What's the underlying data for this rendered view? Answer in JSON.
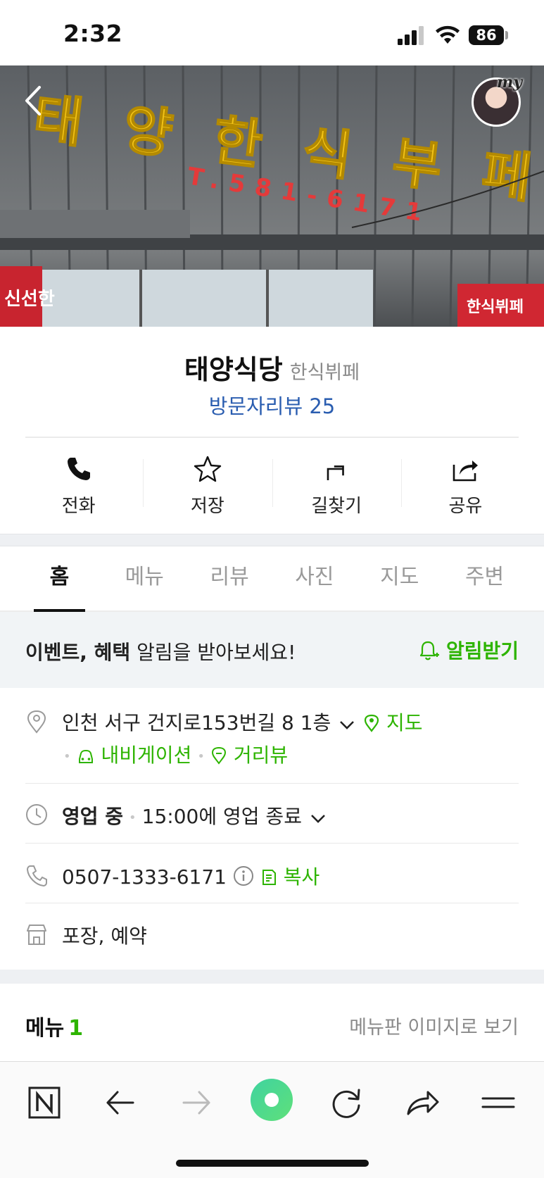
{
  "status_bar": {
    "time": "2:32",
    "battery": "86"
  },
  "hero": {
    "sign_main": "태 양 한 식 부 페",
    "sign_phone": "T.581-6171",
    "sign_side": "한식뷔페",
    "sign_left": "신선한",
    "my_label": "my"
  },
  "place": {
    "name": "태양식당",
    "category": "한식뷔페",
    "review_link": "방문자리뷰 25"
  },
  "actions": [
    {
      "label": "전화",
      "icon": "phone-icon"
    },
    {
      "label": "저장",
      "icon": "star-icon"
    },
    {
      "label": "길찾기",
      "icon": "directions-icon"
    },
    {
      "label": "공유",
      "icon": "share-icon"
    }
  ],
  "tabs": [
    "홈",
    "메뉴",
    "리뷰",
    "사진",
    "지도",
    "주변"
  ],
  "active_tab": "홈",
  "alert": {
    "bold_text": "이벤트, 혜택",
    "text": " 알림을 받아보세요!",
    "button": "알림받기"
  },
  "info": {
    "address": "인천 서구 건지로153번길 8 1층",
    "map_link": "지도",
    "navigation_link": "내비게이션",
    "street_view_link": "거리뷰",
    "hours_status": "영업 중",
    "hours_detail": "15:00에 영업 종료",
    "phone": "0507-1333-6171",
    "copy_link": "복사",
    "services": "포장, 예약"
  },
  "menu_section": {
    "title": "메뉴",
    "count": "1",
    "image_link": "메뉴판 이미지로 보기"
  },
  "colors": {
    "accent_green": "#2db400",
    "link_blue": "#2a5db0"
  }
}
